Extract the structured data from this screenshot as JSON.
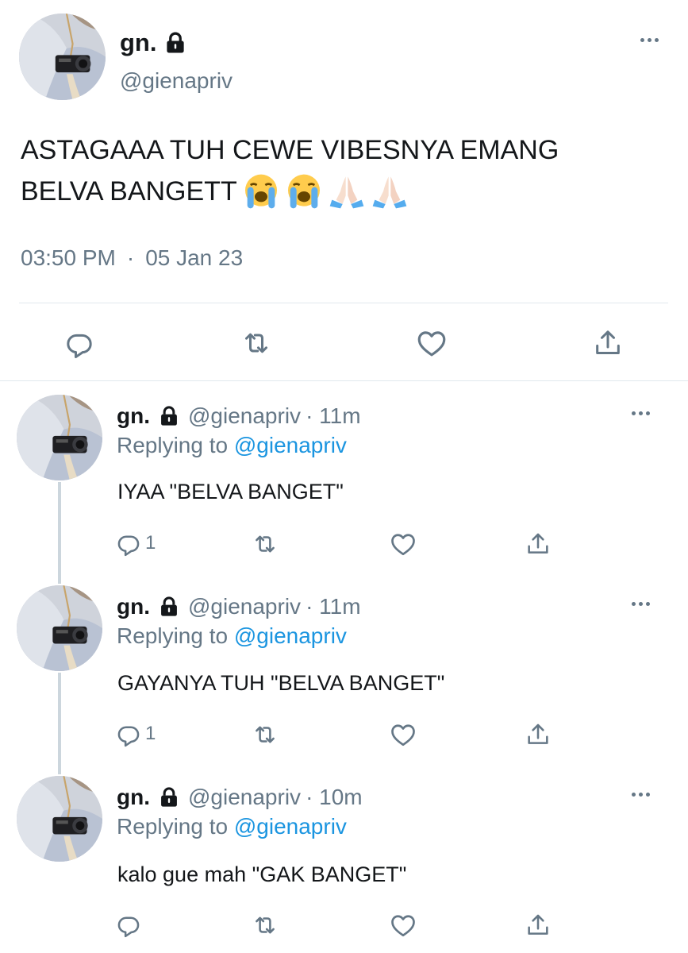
{
  "main_tweet": {
    "display_name": "gn.",
    "handle": "@gienapriv",
    "text": "ASTAGAAA TUH CEWE VIBESNYA EMANG",
    "text_line2": "BELVA BANGETT",
    "emojis": [
      "loudly-crying-face",
      "loudly-crying-face",
      "folded-hands",
      "folded-hands"
    ],
    "time": "03:50 PM",
    "separator": "·",
    "date": "05 Jan 23"
  },
  "replies": [
    {
      "display_name": "gn.",
      "handle": "@gienapriv",
      "time_ago": "· 11m",
      "replying_prefix": "Replying to",
      "replying_to": "@gienapriv",
      "text": "IYAA \"BELVA BANGET\"",
      "reply_count": "1"
    },
    {
      "display_name": "gn.",
      "handle": "@gienapriv",
      "time_ago": "· 11m",
      "replying_prefix": "Replying to",
      "replying_to": "@gienapriv",
      "text": "GAYANYA TUH \"BELVA BANGET\"",
      "reply_count": "1"
    },
    {
      "display_name": "gn.",
      "handle": "@gienapriv",
      "time_ago": "· 10m",
      "replying_prefix": "Replying to",
      "replying_to": "@gienapriv",
      "text": "kalo gue mah \"GAK BANGET\"",
      "reply_count": ""
    }
  ],
  "icons": {
    "more": "more-horizontal-icon",
    "reply": "reply-bubble-icon",
    "retweet": "retweet-icon",
    "like": "heart-icon",
    "share": "share-upload-icon",
    "lock": "lock-icon"
  },
  "colors": {
    "text": "#14171a",
    "muted": "#657786",
    "link": "#1b95e0",
    "divider": "#e1e8ed",
    "thread_line": "#ccd6dd"
  }
}
